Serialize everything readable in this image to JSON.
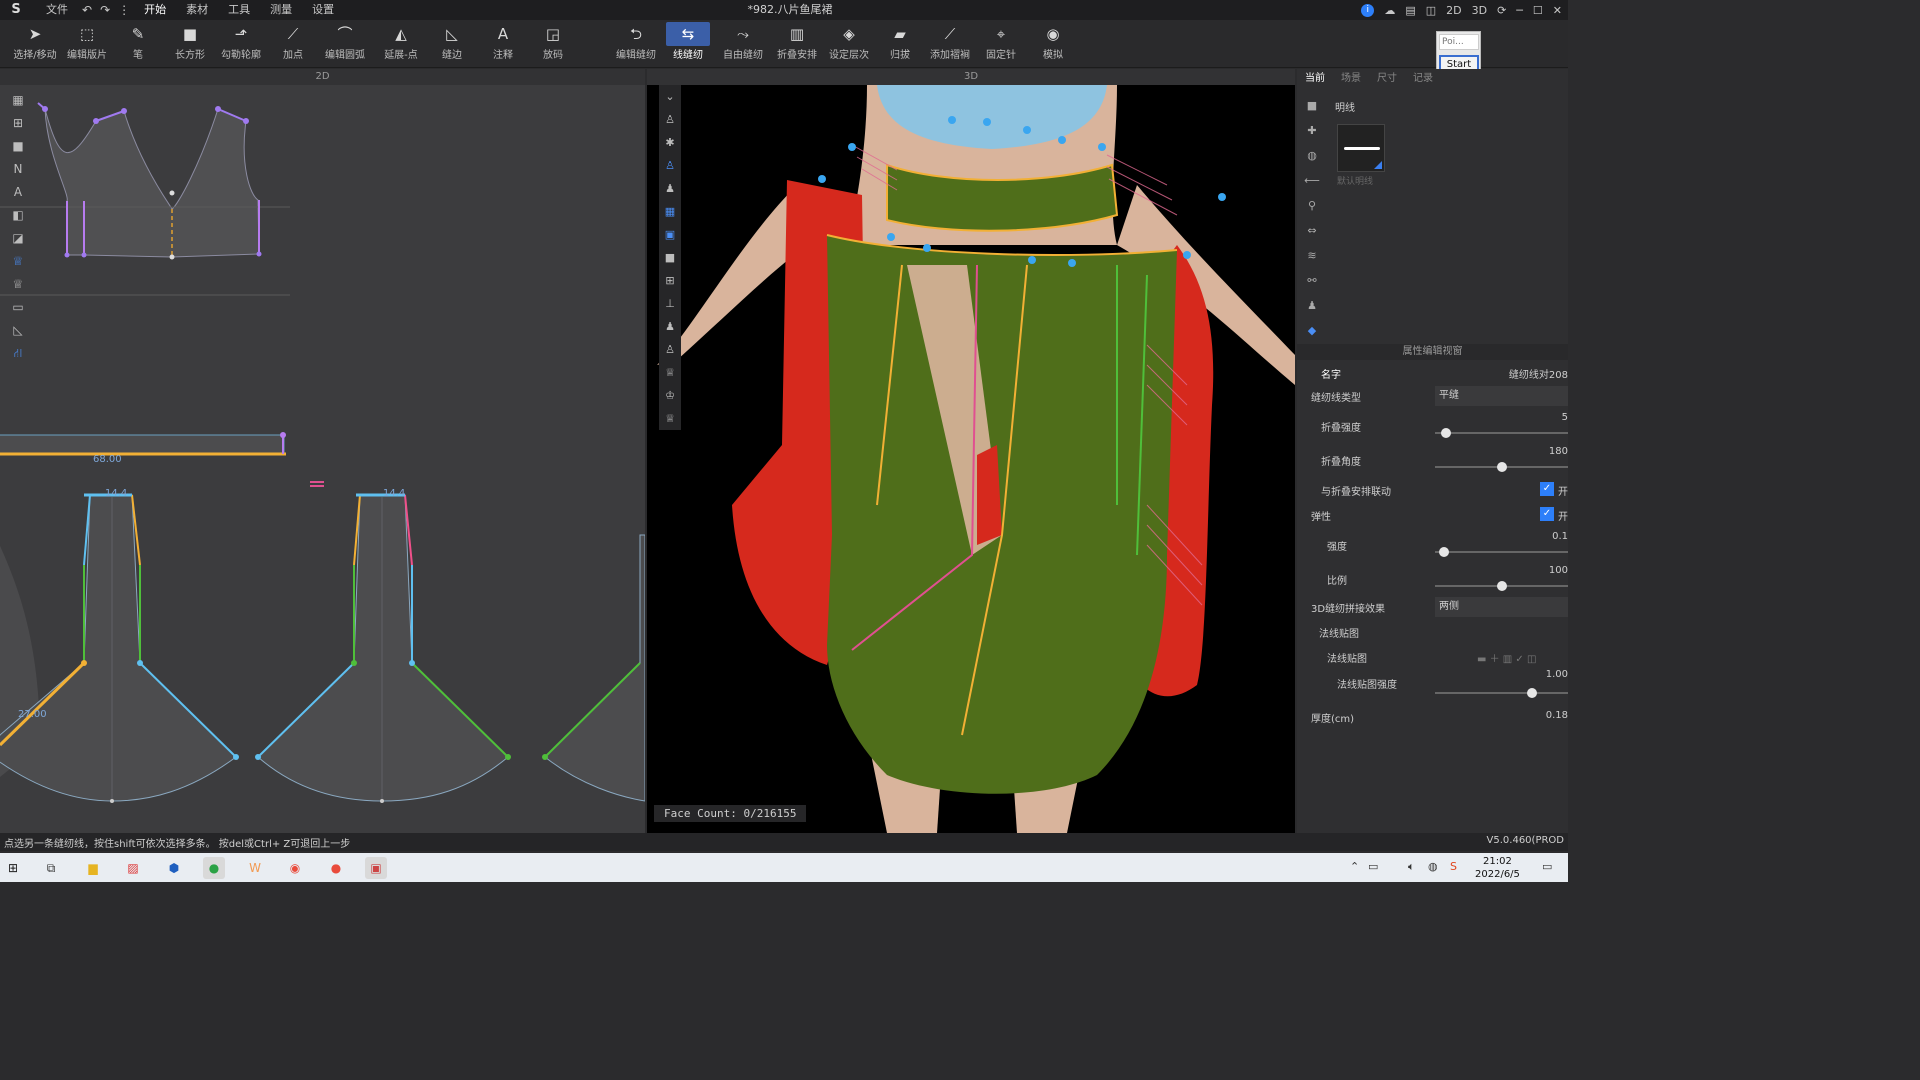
{
  "titlebar": {
    "menu": [
      "文件",
      "开始",
      "素材",
      "工具",
      "测量",
      "设置"
    ],
    "document_title": "*982.八片鱼尾裙",
    "view_buttons": [
      "2D",
      "3D"
    ]
  },
  "toolbar": {
    "tools": [
      "选择/移动",
      "编辑版片",
      "笔",
      "长方形",
      "勾勒轮廓",
      "加点",
      "编辑圆弧",
      "延展-点",
      "缝边",
      "注释",
      "放码",
      "编辑缝纫",
      "线缝纫",
      "自由缝纫",
      "折叠安排",
      "设定层次",
      "归拔",
      "添加褶裥",
      "固定针",
      "模拟"
    ],
    "active": "线缝纫"
  },
  "start_widget": {
    "input_placeholder": "Poi...",
    "button": "Start"
  },
  "panel2d": {
    "title": "2D",
    "measurements": [
      "68.00",
      "14.4",
      "14.4",
      "27.00"
    ]
  },
  "panel3d": {
    "title": "3D",
    "face_count": "Face Count: 0/216155"
  },
  "right_panel": {
    "tabs": [
      "当前",
      "场景",
      "尺寸",
      "记录"
    ],
    "library_title": "明线",
    "thumb_name": "默认明线",
    "property_header": "属性编辑视窗",
    "name_label": "名字",
    "name_value": "缝纫线对208",
    "seam_type_label": "缝纫线类型",
    "seam_type_value": "平缝",
    "fold_strength_label": "折叠强度",
    "fold_strength_value": "5",
    "fold_strength_fraction": 0.05,
    "fold_angle_label": "折叠角度",
    "fold_angle_value": "180",
    "fold_angle_fraction": 0.5,
    "fold_link_label": "与折叠安排联动",
    "fold_link_value": "开",
    "elastic_label": "弹性",
    "elastic_value": "开",
    "strength_label": "强度",
    "strength_value": "0.1",
    "strength_fraction": 0.03,
    "ratio_label": "比例",
    "ratio_value": "100",
    "ratio_fraction": 0.5,
    "seam3d_label": "3D缝纫拼接效果",
    "seam3d_value": "两侧",
    "normal_map_group": "法线贴图",
    "normal_map_label": "法线贴图",
    "normal_strength_label": "法线贴图强度",
    "normal_strength_value": "1.00",
    "normal_strength_fraction": 0.75,
    "thickness_label": "厚度(cm)",
    "thickness_value": "0.18"
  },
  "statusbar": {
    "message": "点选另一条缝纫线，按住shift可依次选择多条。 按del或Ctrl+ Z可退回上一步",
    "version": "V5.0.460(PROD"
  },
  "taskbar": {
    "time": "21:02",
    "date": "2022/6/5"
  },
  "colors": {
    "accent": "#2d7ff9",
    "fabric_green": "#4f6e1a",
    "fabric_red": "#d6291d",
    "pattern_bg": "#3c3c3e"
  }
}
